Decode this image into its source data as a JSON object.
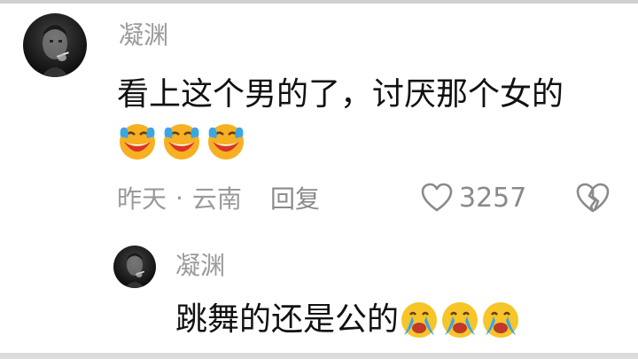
{
  "comment": {
    "username": "凝渊",
    "text": "看上这个男的了，讨厌那个女的",
    "emojis": [
      "laugh-cry-emoji",
      "laugh-cry-emoji",
      "laugh-cry-emoji"
    ],
    "date": "昨天",
    "separator": "·",
    "location": "云南",
    "reply_label": "回复",
    "like_count": "3257",
    "avatar_icon": "avatar-icon"
  },
  "reply": {
    "username": "凝渊",
    "text": "跳舞的还是公的",
    "emojis": [
      "crying-emoji",
      "crying-emoji",
      "crying-emoji"
    ],
    "avatar_icon": "avatar-icon"
  },
  "colors": {
    "username": "#9a9a9a",
    "text": "#111111",
    "meta": "#9a9a9a",
    "background": "#ffffff"
  }
}
